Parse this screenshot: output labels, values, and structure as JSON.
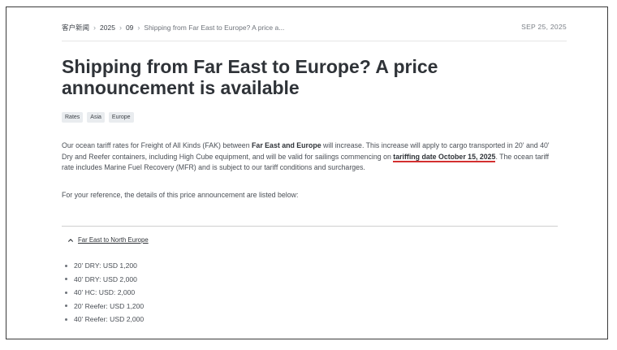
{
  "breadcrumb": {
    "items": [
      "客户新闻",
      "2025",
      "09"
    ],
    "current": "Shipping from Far East to Europe? A price a..."
  },
  "date": "SEP 25, 2025",
  "title": "Shipping from Far East to Europe? A price announcement is available",
  "tags": [
    "Rates",
    "Asia",
    "Europe"
  ],
  "intro": {
    "part1": "Our ocean tariff rates for Freight of All Kinds (FAK) between ",
    "bold1": "Far East and Europe",
    "part2": " will increase. This increase will apply to cargo transported in 20' and 40' Dry and Reefer containers, including High Cube equipment, and will be valid for sailings commencing on ",
    "highlight": "tariffing date October 15, 2025",
    "part3": ". The ocean tariff rate includes Marine Fuel Recovery (MFR) and is subject to our tariff conditions and surcharges."
  },
  "reference": "For your reference, the details of this price announcement are listed below:",
  "accordion": {
    "label": "Far East to North Europe",
    "icon": "chevron-up-icon"
  },
  "rates": [
    "20' DRY: USD 1,200",
    "40' DRY: USD 2,000",
    "40' HC: USD: 2,000",
    "20' Reefer: USD 1,200",
    "40' Reefer: USD 2,000"
  ],
  "colors": {
    "highlight_underline": "#d32f2f",
    "tag_background": "#e9ecef",
    "text": "#4a4f56",
    "heading": "#2f3338"
  }
}
